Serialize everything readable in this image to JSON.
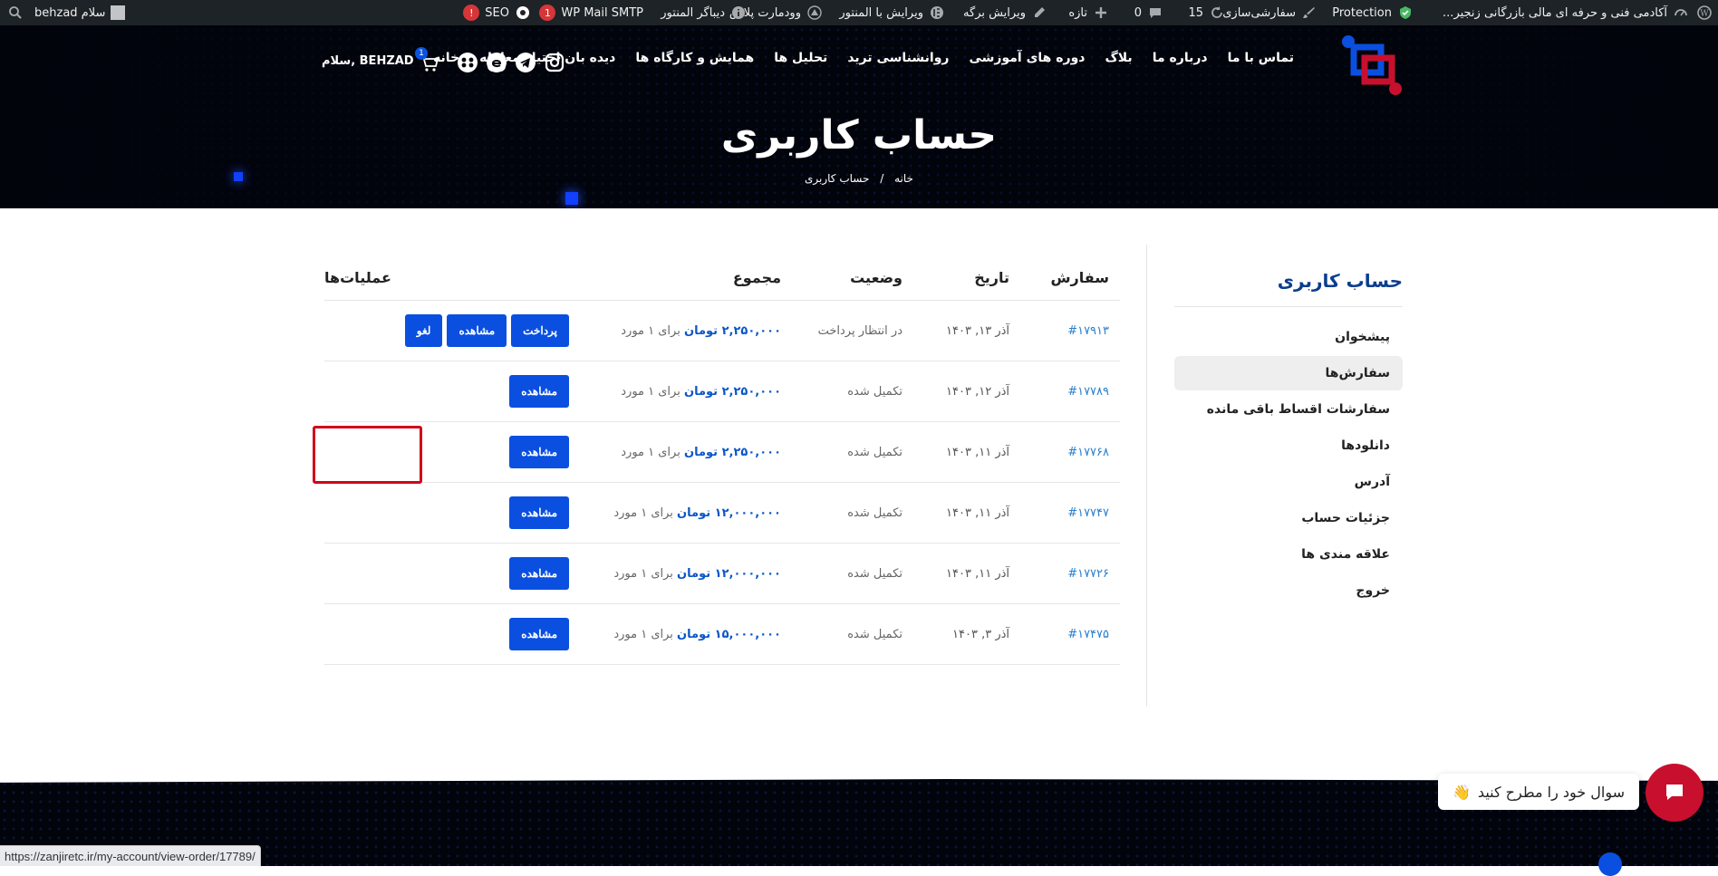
{
  "adminbar": {
    "site_name": "آکادمی فنی و حرفه ای مالی بازرگانی زنجیر...",
    "protection": "Protection",
    "customize": "سفارشی‌سازی",
    "updates_count": "15",
    "comments_count": "0",
    "new": "تازه",
    "edit_page": "ویرایش برگه",
    "edit_elementor": "ویرایش با المنتور",
    "woodmart": "وودمارت پلاس",
    "elementor_debugger": "دیباگر المنتور",
    "wp_mail_smtp": "WP Mail SMTP",
    "wp_mail_badge": "1",
    "seo": "SEO",
    "seo_badge": "!",
    "greeting": "سلام behzad"
  },
  "header": {
    "nav": [
      "خانه",
      "دیده بان اختیار معامله",
      "همایش و کارگاه ها",
      "تحلیل ها",
      "روانشناسی ترید",
      "دوره های آموزشی",
      "بلاگ",
      "درباره ما",
      "تماس با ما"
    ],
    "cart_count": "1",
    "greeting": "سلام, BEHZAD",
    "page_title": "حساب کاربری",
    "breadcrumb_home": "خانه",
    "breadcrumb_sep": "/",
    "breadcrumb_current": "حساب کاربری"
  },
  "sidebar": {
    "title": "حساب کاربری",
    "items": [
      "پیشخوان",
      "سفارش‌ها",
      "سفارشات اقساط باقی مانده",
      "دانلودها",
      "آدرس",
      "جزئیات حساب",
      "علاقه مندی ها",
      "خروج"
    ],
    "active_index": 1
  },
  "orders": {
    "headers": {
      "order": "سفارش",
      "date": "تاریخ",
      "status": "وضعیت",
      "total": "مجموع",
      "actions": "عملیات‌ها"
    },
    "rows": [
      {
        "id": "#۱۷۹۱۳",
        "date": "آذر ۱۳, ۱۴۰۳",
        "status": "در انتظار پرداخت",
        "amount": "۲,۲۵۰,۰۰۰ تومان",
        "qty": "برای ۱ مورد",
        "actions": [
          "پرداخت",
          "مشاهده",
          "لغو"
        ]
      },
      {
        "id": "#۱۷۷۸۹",
        "date": "آذر ۱۲, ۱۴۰۳",
        "status": "تکمیل شده",
        "amount": "۲,۲۵۰,۰۰۰ تومان",
        "qty": "برای ۱ مورد",
        "actions": [
          "مشاهده"
        ]
      },
      {
        "id": "#۱۷۷۶۸",
        "date": "آذر ۱۱, ۱۴۰۳",
        "status": "تکمیل شده",
        "amount": "۲,۲۵۰,۰۰۰ تومان",
        "qty": "برای ۱ مورد",
        "actions": [
          "مشاهده"
        ]
      },
      {
        "id": "#۱۷۷۴۷",
        "date": "آذر ۱۱, ۱۴۰۳",
        "status": "تکمیل شده",
        "amount": "۱۲,۰۰۰,۰۰۰ تومان",
        "qty": "برای ۱ مورد",
        "actions": [
          "مشاهده"
        ]
      },
      {
        "id": "#۱۷۷۲۶",
        "date": "آذر ۱۱, ۱۴۰۳",
        "status": "تکمیل شده",
        "amount": "۱۲,۰۰۰,۰۰۰ تومان",
        "qty": "برای ۱ مورد",
        "actions": [
          "مشاهده"
        ]
      },
      {
        "id": "#۱۷۴۷۵",
        "date": "آذر ۳, ۱۴۰۳",
        "status": "تکمیل شده",
        "amount": "۱۵,۰۰۰,۰۰۰ تومان",
        "qty": "برای ۱ مورد",
        "actions": [
          "مشاهده"
        ]
      }
    ]
  },
  "chat": {
    "bubble_text": "سوال خود را مطرح کنید",
    "bubble_emoji": "👋"
  },
  "statusbar": {
    "url": "https://zanjiretc.ir/my-account/view-order/17789/"
  },
  "colors": {
    "accent": "#0a4fe0",
    "brand_red": "#c8102e",
    "title_blue": "#0a3d8f",
    "highlight": "#d0021b"
  }
}
